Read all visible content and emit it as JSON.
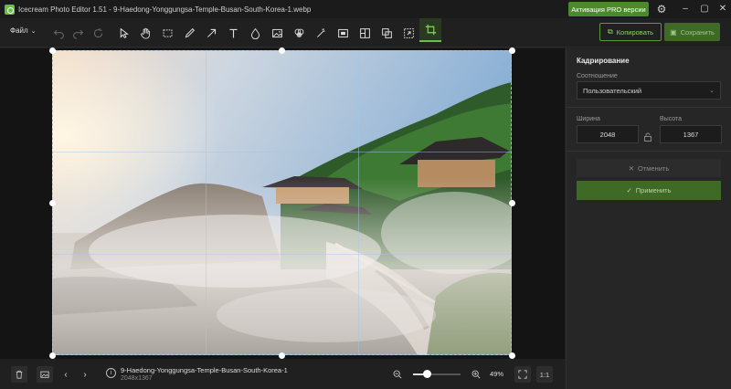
{
  "titlebar": {
    "title": "Icecream Photo Editor 1.51 - 9-Haedong-Yonggungsa-Temple-Busan-South-Korea-1.webp",
    "pro_button": "Активация PRO версии",
    "minimize": "–",
    "maximize": "▢",
    "close": "✕"
  },
  "toolbar": {
    "file_menu": "Файл",
    "copy_label": "Копировать",
    "save_label": "Сохранить",
    "tools": [
      "undo-icon",
      "redo-icon",
      "reset-icon",
      "select-icon",
      "hand-icon",
      "marquee-icon",
      "brush-icon",
      "arrow-icon",
      "text-icon",
      "drop-icon",
      "image-icon",
      "filter-icon",
      "magic-wand-icon",
      "frame-icon",
      "split-icon",
      "layers-icon",
      "resize-icon",
      "crop-icon"
    ],
    "active_tool": "crop-icon"
  },
  "panel": {
    "title": "Кадрирование",
    "ratio_label": "Соотношение",
    "ratio_value": "Пользовательский",
    "width_label": "Ширина",
    "height_label": "Высота",
    "width_value": "2048",
    "height_value": "1367",
    "cancel_label": "Отменить",
    "apply_label": "Применить"
  },
  "bottom": {
    "file_name": "9-Haedong-Yonggungsa-Temple-Busan-South-Korea-1",
    "dimensions": "2048x1367",
    "zoom": "49%",
    "ratio_button": "1:1",
    "zoom_level": 0.49
  },
  "colors": {
    "accent": "#6ac043",
    "pro_button": "#4b8a2c",
    "apply": "#3e6a26"
  }
}
